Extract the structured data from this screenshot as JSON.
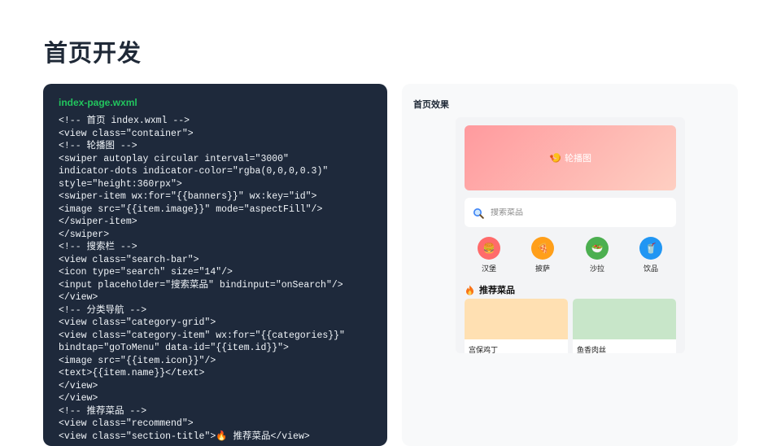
{
  "page": {
    "title": "首页开发"
  },
  "code": {
    "filename": "index-page.wxml",
    "lines": [
      "<!-- 首页 index.wxml -->",
      "<view class=\"container\">",
      "<!-- 轮播图 -->",
      "<swiper autoplay circular interval=\"3000\"",
      "indicator-dots indicator-color=\"rgba(0,0,0,0.3)\"",
      "style=\"height:360rpx\">",
      "<swiper-item wx:for=\"{{banners}}\" wx:key=\"id\">",
      "<image src=\"{{item.image}}\" mode=\"aspectFill\"/>",
      "</swiper-item>",
      "</swiper>",
      "<!-- 搜索栏 -->",
      "<view class=\"search-bar\">",
      "<icon type=\"search\" size=\"14\"/>",
      "<input placeholder=\"搜索菜品\" bindinput=\"onSearch\"/>",
      "</view>",
      "<!-- 分类导航 -->",
      "<view class=\"category-grid\">",
      "<view class=\"category-item\" wx:for=\"{{categories}}\"",
      "bindtap=\"goToMenu\" data-id=\"{{item.id}}\">",
      "<image src=\"{{item.icon}}\"/>",
      "<text>{{item.name}}</text>",
      "</view>",
      "</view>",
      "<!-- 推荐菜品 -->",
      "<view class=\"recommend\">",
      "<view class=\"section-title\">🔥 推荐菜品</view>"
    ]
  },
  "preview": {
    "label": "首页效果",
    "banner": {
      "icon": "🍤",
      "label": "轮播图"
    },
    "search": {
      "placeholder": "搜索菜品",
      "icon": "magnifier-icon"
    },
    "categories": [
      {
        "name": "汉堡",
        "icon": "🍔",
        "color": "#ff6b6b"
      },
      {
        "name": "披萨",
        "icon": "🍕",
        "color": "#ff9f1a"
      },
      {
        "name": "沙拉",
        "icon": "🥗",
        "color": "#4caf50"
      },
      {
        "name": "饮品",
        "icon": "🥤",
        "color": "#2196f3"
      }
    ],
    "recommend_title": "推荐菜品",
    "dishes": [
      {
        "name": "宫保鸡丁",
        "color": "#ffe0b2"
      },
      {
        "name": "鱼香肉丝",
        "color": "#c8e6c9"
      }
    ]
  }
}
